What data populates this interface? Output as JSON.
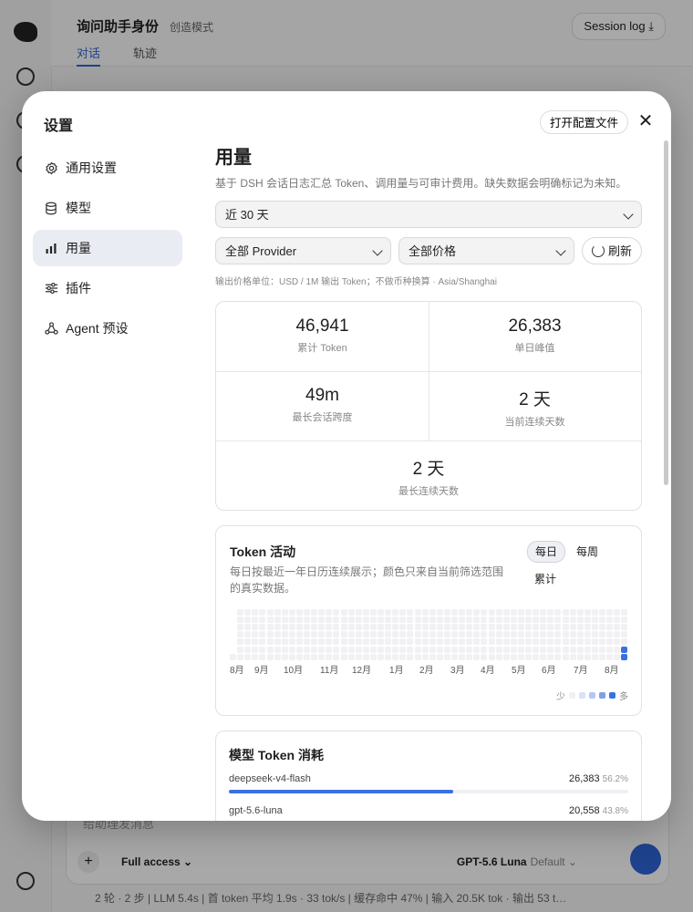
{
  "app": {
    "title": "询问助手身份",
    "mode": "创造模式",
    "tabs": [
      "对话",
      "轨迹"
    ],
    "session_log": "Session log ⤓",
    "composer": {
      "placeholder": "给助理发消息",
      "access": "Full access ⌄",
      "model": "GPT-5.6 Luna",
      "model_default": "Default ⌄"
    },
    "status_line": "2 轮 · 2 步  |  LLM 5.4s  |  首 token 平均 1.9s · 33 tok/s  |  缓存命中 47%  |  输入 20.5K tok · 输出 53 t…"
  },
  "modal": {
    "title": "设置",
    "open_config": "打开配置文件",
    "close": "✕",
    "nav": [
      {
        "label": "通用设置",
        "icon": "gear-icon"
      },
      {
        "label": "模型",
        "icon": "database-icon"
      },
      {
        "label": "用量",
        "icon": "bar-chart-icon",
        "active": true
      },
      {
        "label": "插件",
        "icon": "sliders-icon"
      },
      {
        "label": "Agent 预设",
        "icon": "agent-network-icon"
      }
    ]
  },
  "usage": {
    "title": "用量",
    "description": "基于 DSH 会话日志汇总 Token、调用量与可审计费用。缺失数据会明确标记为未知。",
    "range": "近 30 天",
    "provider": "全部 Provider",
    "price": "全部价格",
    "refresh": "刷新",
    "unit_note": "输出价格单位：USD / 1M 输出 Token；不做币种换算 · Asia/Shanghai",
    "stats": [
      {
        "value": "46,941",
        "label": "累计 Token"
      },
      {
        "value": "26,383",
        "label": "单日峰值"
      },
      {
        "value": "49m",
        "label": "最长会话跨度"
      },
      {
        "value": "2 天",
        "label": "当前连续天数"
      },
      {
        "value": "2 天",
        "label": "最长连续天数"
      }
    ],
    "activity": {
      "title": "Token 活动",
      "description": "每日按最近一年日历连续展示；颜色只来自当前筛选范围的真实数据。",
      "toggles": [
        "每日",
        "每周",
        "累计"
      ],
      "active_toggle": "每日",
      "months": [
        "8月",
        "9月",
        "10月",
        "11月",
        "12月",
        "1月",
        "2月",
        "3月",
        "4月",
        "5月",
        "6月",
        "7月",
        "8月"
      ],
      "legend_less": "少",
      "legend_more": "多",
      "legend_colors": [
        "#f1f1f4",
        "#d8e2fb",
        "#b3c7f4",
        "#7e9fe9",
        "#3a70e0"
      ],
      "active_days": [
        {
          "week": 53,
          "day": 5,
          "level": 4
        },
        {
          "week": 53,
          "day": 6,
          "level": 4
        }
      ]
    },
    "models": {
      "title": "模型 Token 消耗",
      "items": [
        {
          "name": "deepseek-v4-flash",
          "tokens": "26,383",
          "share": 0.562,
          "share_label": "56.2%"
        },
        {
          "name": "gpt-5.6-luna",
          "tokens": "20,558",
          "share": 0.438,
          "share_label": "43.8%"
        }
      ]
    }
  }
}
